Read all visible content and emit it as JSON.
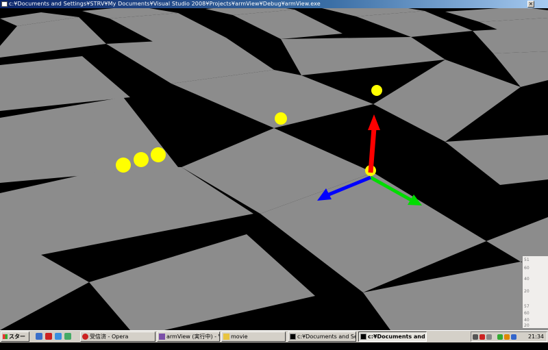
{
  "window": {
    "title": "c:¥Documents and Settings¥STRV¥My Documents¥Visual Studio 2008¥Projects¥armView¥Debug¥armView.exe",
    "close_glyph": "×"
  },
  "scene": {
    "floor_light": "#8c8c8c",
    "floor_dark": "#000000",
    "marker_color": "#ffff00",
    "axis_up_color": "#ff0000",
    "axis_right_color": "#00dd00",
    "axis_left_color": "#0000ff"
  },
  "taskbar": {
    "start_label": "スタート",
    "tasks": [
      {
        "label": "受信済 - Opera",
        "active": false
      },
      {
        "label": "armView (実行中) - Vis...",
        "active": false
      },
      {
        "label": "movie",
        "active": false
      },
      {
        "label": "c:¥Documents and Setti...",
        "active": false
      },
      {
        "label": "c:¥Documents and S...",
        "active": true
      }
    ],
    "clock": "21:34"
  },
  "side_widget": {
    "labels": [
      "51",
      "60",
      "40",
      "20",
      "57",
      "60",
      "40",
      "20"
    ]
  }
}
